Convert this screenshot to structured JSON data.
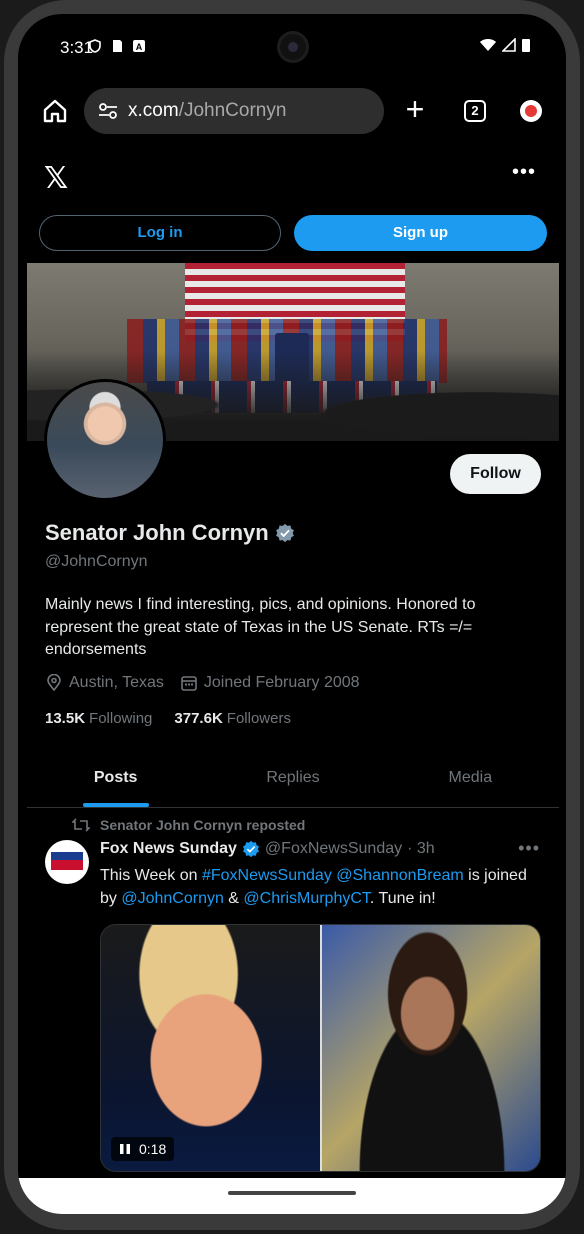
{
  "status_bar": {
    "time": "3:31"
  },
  "browser": {
    "url_domain": "x.com",
    "url_path": "/JohnCornyn",
    "tab_count": "2"
  },
  "header": {
    "logo": "𝕏",
    "more": "•••"
  },
  "auth": {
    "login_label": "Log in",
    "signup_label": "Sign up"
  },
  "profile": {
    "display_name": "Senator John Cornyn",
    "handle": "@JohnCornyn",
    "bio": "Mainly news I find interesting, pics, and opinions. Honored to represent the great state of Texas in the US Senate. RTs =/= endorsements",
    "location": "Austin, Texas",
    "joined": "Joined February 2008",
    "following_count": "13.5K",
    "following_label": "Following",
    "followers_count": "377.6K",
    "followers_label": "Followers",
    "follow_label": "Follow"
  },
  "tabs": [
    {
      "label": "Posts",
      "active": true
    },
    {
      "label": "Replies",
      "active": false
    },
    {
      "label": "Media",
      "active": false
    }
  ],
  "post": {
    "repost_text": "Senator John Cornyn reposted",
    "author": "Fox News Sunday",
    "handle": "@FoxNewsSunday",
    "time": "· 3h",
    "more": "•••",
    "text_1": "This Week on ",
    "link_1": "#FoxNewsSunday",
    "text_2": " ",
    "link_2": "@ShannonBream",
    "text_3": " is joined by ",
    "link_3": "@JohnCornyn",
    "text_4": " & ",
    "link_4": "@ChrisMurphyCT",
    "text_5": ". Tune in!",
    "video_time": "0:18"
  },
  "colors": {
    "accent": "#1d9bf0",
    "background": "#000000",
    "muted_text": "#71767b"
  }
}
